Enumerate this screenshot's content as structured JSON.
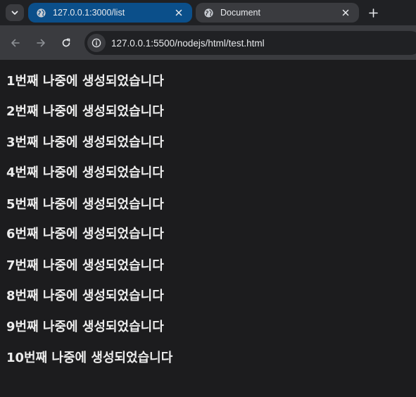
{
  "tabs": [
    {
      "title": "127.0.0.1:3000/list",
      "active": true
    },
    {
      "title": "Document",
      "active": false
    }
  ],
  "icons": {
    "tab_list": "chevron-down-icon",
    "favicon": "globe-icon",
    "close": "close-icon",
    "new_tab": "plus-icon",
    "back": "arrow-left-icon",
    "forward": "arrow-right-icon",
    "reload": "reload-icon",
    "site_info": "info-icon"
  },
  "address_bar": {
    "url": "127.0.0.1:5500/nodejs/html/test.html"
  },
  "content": {
    "items": [
      "1번째 나중에 생성되었습니다",
      "2번째 나중에 생성되었습니다",
      "3번째 나중에 생성되었습니다",
      "4번째 나중에 생성되었습니다",
      "5번째 나중에 생성되었습니다",
      "6번째 나중에 생성되었습니다",
      "7번째 나중에 생성되었습니다",
      "8번째 나중에 생성되었습니다",
      "9번째 나중에 생성되었습니다",
      "10번째 나중에 생성되었습니다"
    ]
  },
  "colors": {
    "page_background": "#1c1c1e",
    "active_tab": "#0b4f8a",
    "toolbar": "#3a3b3f",
    "text": "#ededed"
  }
}
